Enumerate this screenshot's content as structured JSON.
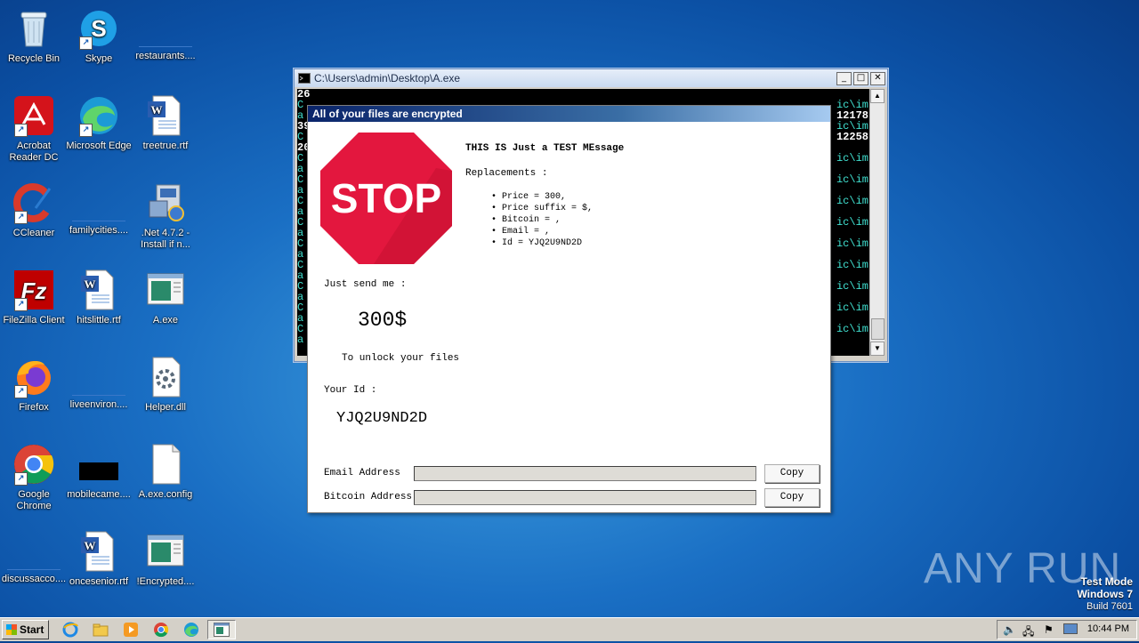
{
  "desktop": {
    "icons": [
      {
        "label": "Recycle Bin"
      },
      {
        "label": "Skype"
      },
      {
        "label": "restaurants...."
      },
      {
        "label": "Acrobat Reader DC"
      },
      {
        "label": "Microsoft Edge"
      },
      {
        "label": "treetrue.rtf"
      },
      {
        "label": "CCleaner"
      },
      {
        "label": "familycities...."
      },
      {
        "label": ".Net 4.7.2 - Install if n..."
      },
      {
        "label": "FileZilla Client"
      },
      {
        "label": "hitslittle.rtf"
      },
      {
        "label": "A.exe"
      },
      {
        "label": "Firefox"
      },
      {
        "label": "liveenviron...."
      },
      {
        "label": "Helper.dll"
      },
      {
        "label": "Google Chrome"
      },
      {
        "label": "mobilecame...."
      },
      {
        "label": "A.exe.config"
      },
      {
        "label": "discussacco...."
      },
      {
        "label": "oncesenior.rtf"
      },
      {
        "label": "!Encrypted...."
      }
    ]
  },
  "console": {
    "title": "C:\\Users\\admin\\Desktop\\A.exe",
    "lines": [
      {
        "left": "26",
        "right": ""
      },
      {
        "left": "C",
        "right": "ic\\im"
      },
      {
        "left": "a",
        "right": "12178"
      },
      {
        "left": "39",
        "right": "ic\\im"
      },
      {
        "left": "C",
        "right": "12258"
      },
      {
        "left": "20",
        "right": ""
      },
      {
        "left": "C",
        "right": "ic\\im"
      },
      {
        "left": "a",
        "right": ""
      },
      {
        "left": "C",
        "right": "ic\\im"
      },
      {
        "left": "a",
        "right": ""
      },
      {
        "left": "C",
        "right": "ic\\im"
      },
      {
        "left": "a",
        "right": ""
      },
      {
        "left": "C",
        "right": "ic\\im"
      },
      {
        "left": "a",
        "right": ""
      },
      {
        "left": "C",
        "right": "ic\\im"
      },
      {
        "left": "a",
        "right": ""
      },
      {
        "left": "C",
        "right": "ic\\im"
      },
      {
        "left": "a",
        "right": ""
      },
      {
        "left": "C",
        "right": "ic\\im"
      },
      {
        "left": "a",
        "right": ""
      },
      {
        "left": "C",
        "right": "ic\\im"
      },
      {
        "left": "a",
        "right": ""
      },
      {
        "left": "C",
        "right": "ic\\im"
      },
      {
        "left": "a",
        "right": ""
      }
    ]
  },
  "dialog": {
    "title": "All of your files are encrypted",
    "stop_text": "STOP",
    "message_title": "THIS IS Just a TEST MEssage",
    "replacements_label": "Replacements :",
    "replacements": [
      "Price = 300,",
      "Price suffix = $,",
      "Bitcoin = ,",
      "Email = ,",
      "Id = YJQ2U9ND2D"
    ],
    "just_send_label": "Just send me :",
    "amount": "300$",
    "unlock_text": "To unlock your files",
    "your_id_label": "Your Id :",
    "id_value": "YJQ2U9ND2D",
    "email_label": "Email Address",
    "email_value": "",
    "bitcoin_label": "Bitcoin Address",
    "bitcoin_value": "",
    "copy_label": "Copy"
  },
  "watermark": {
    "brand": "ANY RUN",
    "test_mode": "Test Mode",
    "os": "Windows 7",
    "build": "Build 7601"
  },
  "taskbar": {
    "start_label": "Start",
    "clock": "10:44 PM"
  },
  "colors": {
    "stop_red": "#e3173e",
    "desktop_blue": "#1a6fc4",
    "console_text": "#c0c0c0",
    "console_accent": "#40e0d0"
  }
}
